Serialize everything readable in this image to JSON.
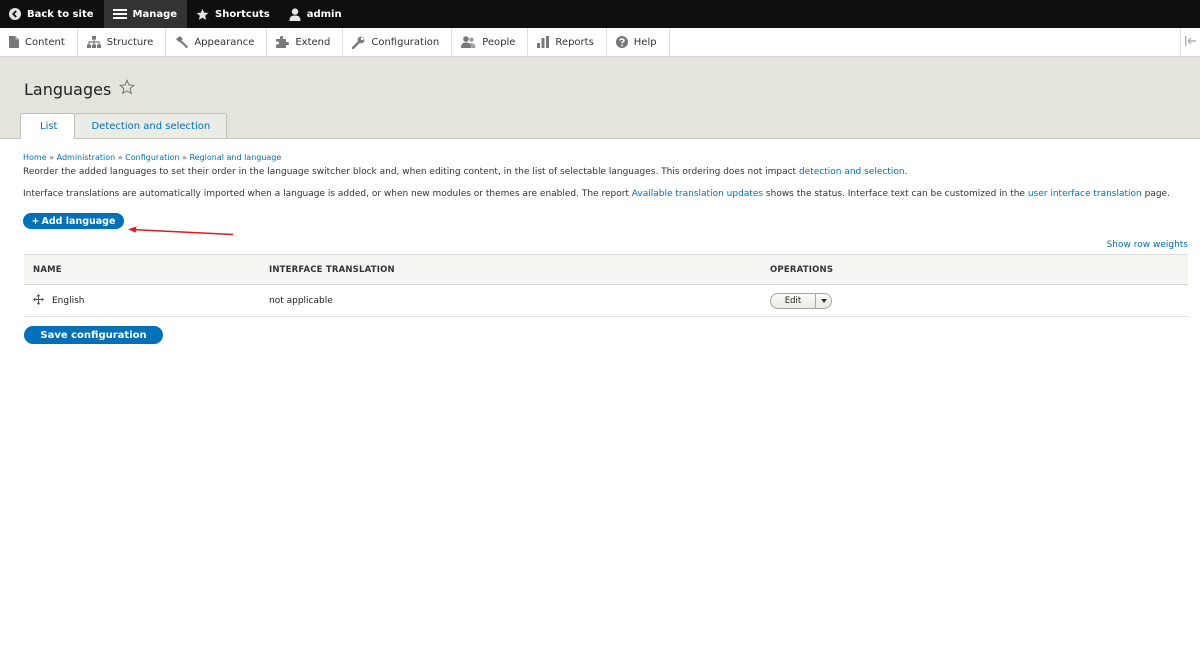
{
  "toolbar": {
    "back_to_site": "Back to site",
    "manage": "Manage",
    "shortcuts": "Shortcuts",
    "user": "admin"
  },
  "tray": {
    "items": [
      {
        "label": "Content",
        "icon": "file-icon"
      },
      {
        "label": "Structure",
        "icon": "sitemap-icon"
      },
      {
        "label": "Appearance",
        "icon": "paintbrush-icon"
      },
      {
        "label": "Extend",
        "icon": "puzzle-icon"
      },
      {
        "label": "Configuration",
        "icon": "wrench-icon"
      },
      {
        "label": "People",
        "icon": "people-icon"
      },
      {
        "label": "Reports",
        "icon": "bar-chart-icon"
      },
      {
        "label": "Help",
        "icon": "help-icon"
      }
    ]
  },
  "page": {
    "title": "Languages",
    "tabs": [
      {
        "label": "List",
        "active": true
      },
      {
        "label": "Detection and selection",
        "active": false
      }
    ]
  },
  "breadcrumb": [
    "Home",
    "Administration",
    "Configuration",
    "Regional and language"
  ],
  "breadcrumb_separator": "»",
  "intro": {
    "p1_text": "Reorder the added languages to set their order in the language switcher block and, when editing content, in the list of selectable languages. This ordering does not impact ",
    "p1_link": "detection and selection",
    "p1_end": ".",
    "p2_text_a": "Interface translations are automatically imported when a language is added, or when new modules or themes are enabled. The report ",
    "p2_link_a": "Available translation updates",
    "p2_text_b": " shows the status. Interface text can be customized in the ",
    "p2_link_b": "user interface translation",
    "p2_text_c": " page."
  },
  "actions": {
    "add_language_prefix": "+",
    "add_language": "Add language",
    "show_row_weights": "Show row weights",
    "save": "Save configuration"
  },
  "table": {
    "headers": [
      "NAME",
      "INTERFACE TRANSLATION",
      "OPERATIONS"
    ],
    "rows": [
      {
        "name": "English",
        "translation": "not applicable",
        "operation": "Edit"
      }
    ]
  },
  "colors": {
    "link": "#0071b8",
    "primary_button": "#0071b8",
    "toolbar": "#0f0f0f",
    "header_bg": "#e4e4dc",
    "annotation_arrow": "#e01b1b"
  }
}
